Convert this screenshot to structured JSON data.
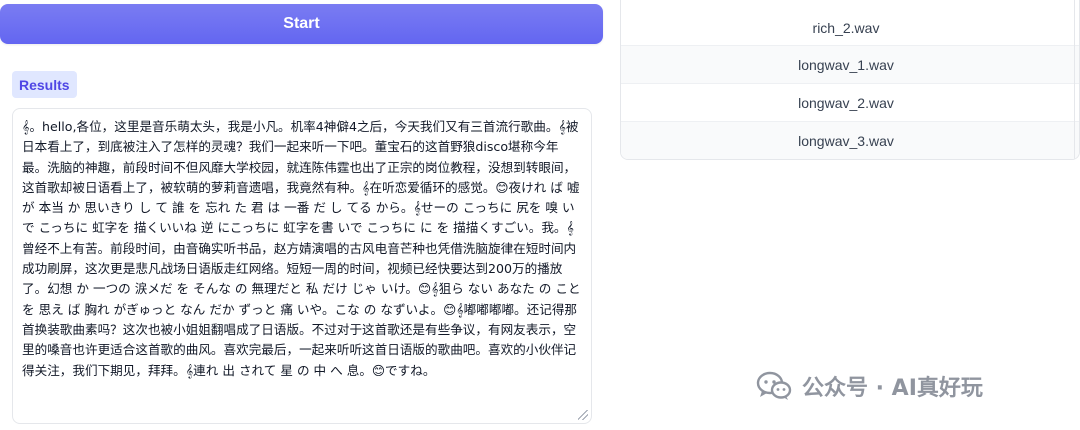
{
  "start_button": {
    "label": "Start"
  },
  "results": {
    "label": "Results",
    "text": "𝄞。hello,各位，这里是音乐萌太头，我是小凡。机率4神僻4之后，今天我们又有三首流行歌曲。𝄞被日本看上了，到底被注入了怎样的灵魂？我们一起来听一下吧。董宝石的这首野狼disco堪称今年最。洗脑的神趣，前段时间不但风靡大学校园，就连陈伟霆也出了正宗的岗位教程，没想到转眼间，这首歌却被日语看上了，被软萌的萝莉音遗唱，我竟然有种。𝄞在听恋爱循环的感觉。😊夜けれ ば 嘘 が 本当 か 思いきり し て 誰 を 忘れ た 君 は 一番 だ し てる から。𝄞せーの こっちに 尻を 嗅 いで こっちに 虹字を 描くいいね 逆 にこっちに 虹字を書 いで こっちに に を 描描くすごい。我。𝄞曾经不上有苦。前段时间，由音确实听书品，赵方婧演唱的古风电音芒种也凭借洗脑旋律在短时间内成功刷屏，这次更是悲凡战场日语版走红网络。短短一周的时间，视频已经快要达到200万的播放了。幻想 か 一つの 涙メだ を そんな の 無理だと 私 だけ じゃ いけ。😊𝄞狙ら ない あなた の こと を 思え ば 胸れ がぎゅっと なん だか ずっと 痛 いや。こな の なずいよ。😊𝄞嘟嘟嘟嘟。还记得那首换装歌曲素吗？这次也被小姐姐翻唱成了日语版。不过对于这首歌还是有些争议，有网友表示，空里的嗓音也许更适合这首歌的曲风。喜欢完最后，一起来听听这首日语版的歌曲吧。喜欢的小伙伴记得关注，我们下期见，拜拜。𝄞連れ 出 されて 星 の 中 へ 息。😊ですね。"
  },
  "files": [
    {
      "name": "rich_2.wav"
    },
    {
      "name": "longwav_1.wav"
    },
    {
      "name": "longwav_2.wav"
    },
    {
      "name": "longwav_3.wav"
    }
  ],
  "watermark": {
    "text": "公众号 · AI真好玩",
    "icon": "wechat-icon"
  },
  "colors": {
    "accent": "#6366f1",
    "label_bg": "#e0e7ff",
    "label_text": "#4f46e5"
  }
}
